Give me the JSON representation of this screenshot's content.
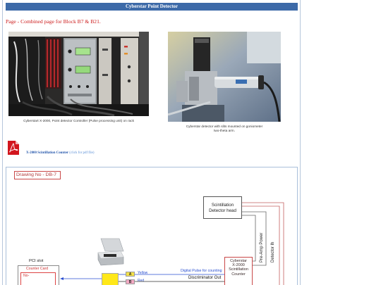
{
  "page": {
    "title": "Cyberstar Point Detector",
    "intro": "Page - Combined page for Block B7 & B21."
  },
  "photos": [
    {
      "caption": "Cyberstart X-2000, Point detector Controller (Pulse processing unit) on rack"
    },
    {
      "caption_lines": [
        "Cyberstar detector with slits mounted on goniometer",
        "two-theta arm."
      ]
    }
  ],
  "pdf_link": {
    "icon": "pdf-icon",
    "title": "X-2000 Scintillation Counter",
    "note": "(click for pdf file)"
  },
  "drawing": {
    "title": "Drawing No - DB-7",
    "detector_head": [
      "Scintillation",
      "Detector head"
    ],
    "counter_unit": [
      "Cyberstar",
      "X-2000",
      "Scintillation",
      "Counter"
    ],
    "pci_slot": "PCI slot",
    "counter_card": "Counter Card",
    "counter_card_no": "No-",
    "signal_a": {
      "tag": "A",
      "wire": "Yellow"
    },
    "signal_b": {
      "tag": "B",
      "wire": "Red"
    },
    "digital_pulse": "Digital Pulse for counting",
    "discriminator_out": "Discriminator Out",
    "preamp_power": "Pre-Amp Power",
    "detector_signal": "Detector Ih"
  },
  "colors": {
    "header_bg": "#3d6aa8",
    "intro_red": "#cc1a1a",
    "link_blue": "#2456ab",
    "link_note": "#5b8fd6",
    "drawing_red": "#c94848",
    "signal_blue": "#2a4fd0",
    "tag_a": "#f2e04a",
    "tag_b": "#f3a9c3",
    "card_yellow": "#ffe81a"
  }
}
